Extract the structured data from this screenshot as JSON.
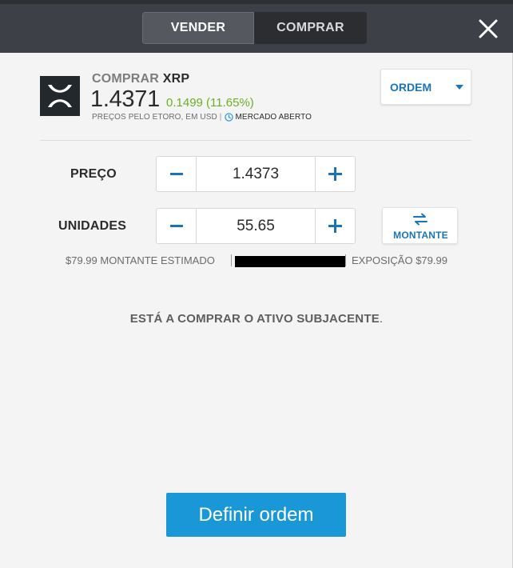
{
  "header": {
    "tabs": [
      {
        "label": "VENDER",
        "active": true
      },
      {
        "label": "COMPRAR",
        "active": false
      }
    ],
    "close_icon": "close-icon"
  },
  "asset": {
    "action": "COMPRAR",
    "symbol": "XRP",
    "price": "1.4371",
    "change": "0.1499 (11.65%)",
    "prices_note": "PREÇOS PELO ETORO, EM USD",
    "separator": "|",
    "market_status": "MERCADO ABERTO",
    "logo_icon": "xrp-logo"
  },
  "order_type": {
    "label": "ORDEM",
    "icon": "chevron-down-icon"
  },
  "form": {
    "price_label": "PREÇO",
    "price_value": "1.4373",
    "units_label": "UNIDADES",
    "units_value": "55.65",
    "toggle_label": "MONTANTE"
  },
  "summary": {
    "estimated": "$79.99 MONTANTE ESTIMADO",
    "exposure": "EXPOSIÇÃO $79.99"
  },
  "notice": {
    "text": "ESTÁ A COMPRAR O ATIVO SUBJACENTE",
    "suffix": "."
  },
  "submit_label": "Definir ordem",
  "colors": {
    "accent": "#1a75b8",
    "button": "#1a97d6",
    "positive": "#6ab023",
    "header": "#3d4047"
  }
}
